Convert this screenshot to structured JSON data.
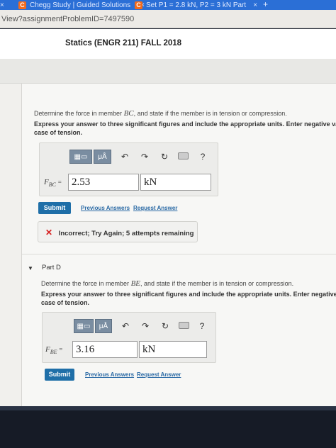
{
  "browser": {
    "tabs": [
      {
        "icon": "C",
        "label": "Chegg Study | Guided Solutions",
        "close": "×"
      },
      {
        "icon": "C",
        "label": "Set P1 = 2.8 kN, P2 = 3 kN Part",
        "close": "×"
      }
    ],
    "new_tab": "+",
    "url": "View?assignmentProblemID=7497590"
  },
  "header": {
    "course_title": "Statics (ENGR 211) FALL 2018"
  },
  "part_c": {
    "question_prefix": "Determine the force in member",
    "member": "BC",
    "question_suffix": ", and state if the member is in tension or compression.",
    "instructions_line1": "Express your answer to three significant figures and include the appropriate units. Enter negative va",
    "instructions_line2": "case of tension.",
    "variable": "F",
    "variable_sub": "BC",
    "equals": "=",
    "value": "2.53",
    "units": "kN",
    "submit_label": "Submit",
    "previous_answers": "Previous Answers",
    "request_answer": "Request Answer",
    "feedback_icon": "✕",
    "feedback": "Incorrect; Try Again; 5 attempts remaining"
  },
  "part_d": {
    "label": "Part D",
    "caret": "▼",
    "question_prefix": "Determine the force in member",
    "member": "BE",
    "question_suffix": ", and state if the member is in tension or compression.",
    "instructions_line1": "Express your answer to three significant figures and include the appropriate units. Enter negative valu",
    "instructions_line2": "case of tension.",
    "variable": "F",
    "variable_sub": "BE",
    "equals": "=",
    "value": "3.16",
    "units": "kN",
    "submit_label": "Submit",
    "previous_answers": "Previous Answers",
    "request_answer": "Request Answer"
  },
  "toolbar": {
    "mu_label": "μÅ",
    "undo": "↶",
    "redo": "↷",
    "reset": "↻",
    "help": "?"
  },
  "colors": {
    "tab_bar": "#2b6fd6",
    "submit": "#1f6fa8",
    "link": "#2b6aa5",
    "error": "#d62020"
  }
}
